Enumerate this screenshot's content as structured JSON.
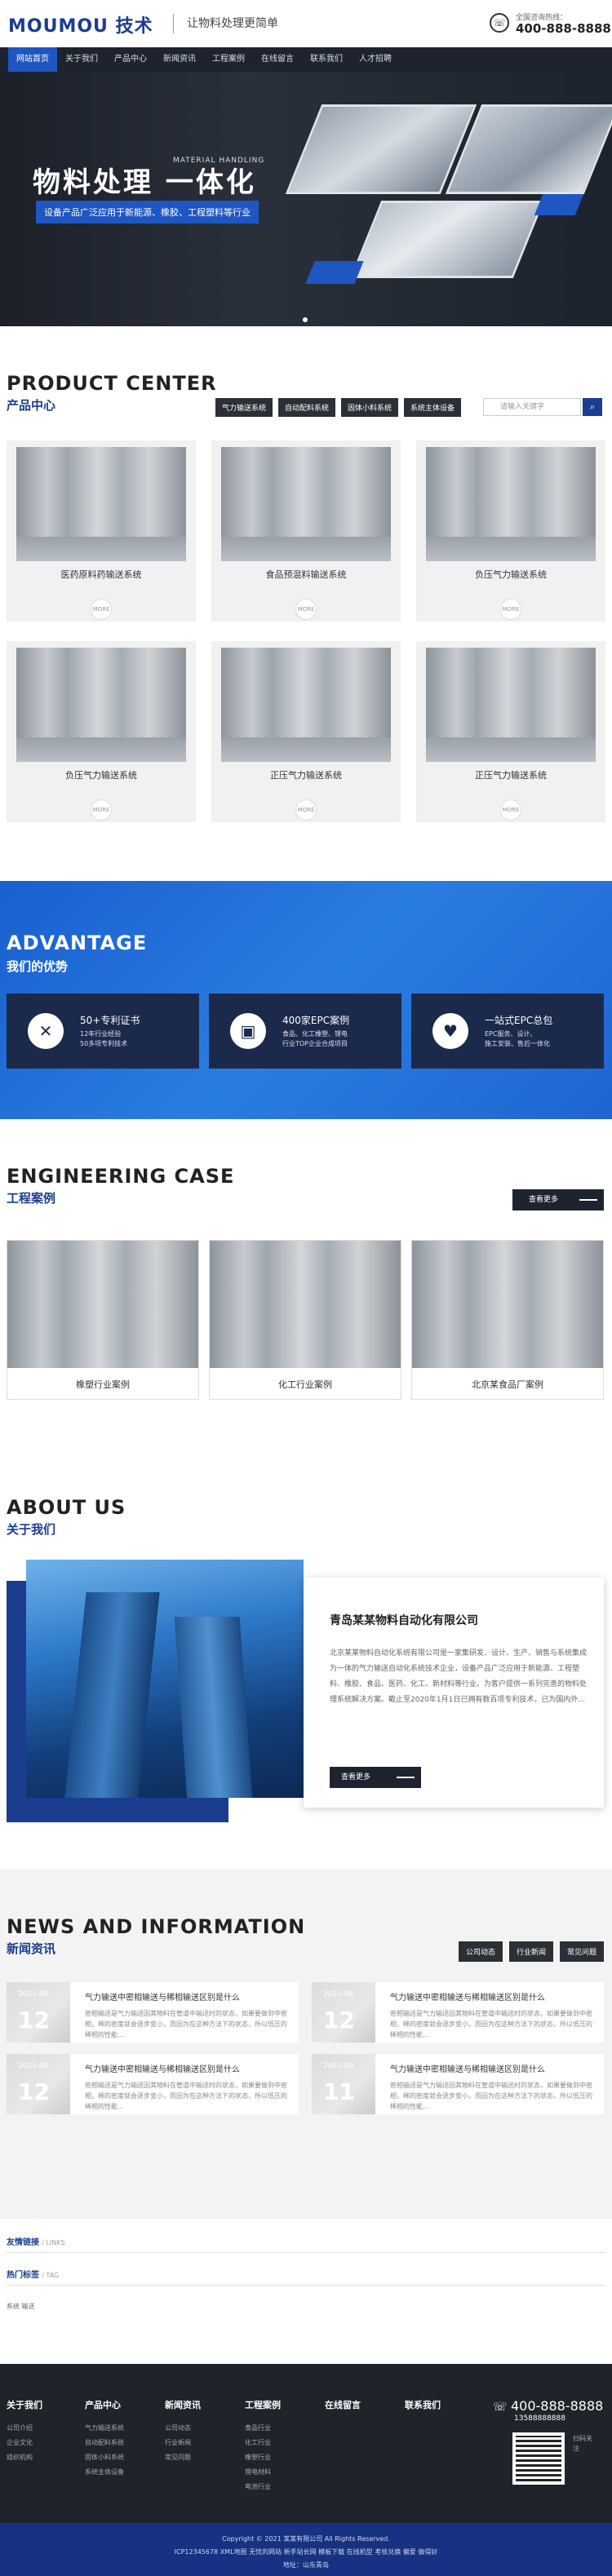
{
  "header": {
    "logo": "MOUMOU 技术",
    "slogan": "让物料处理更简单",
    "hotline_label": "全国咨询热线：",
    "hotline": "400-888-8888",
    "phone_icon": "phone-icon"
  },
  "nav": [
    "网站首页",
    "关于我们",
    "产品中心",
    "新闻资讯",
    "工程案例",
    "在线留言",
    "联系我们",
    "人才招聘"
  ],
  "banner": {
    "title": "物料处理 一体化",
    "subtitle": "MATERIAL HANDLING",
    "tagline": "设备产品广泛应用于新能源、橡胶、工程塑料等行业"
  },
  "products": {
    "title_en": "PRODUCT CENTER",
    "title_cn": "产品中心",
    "tabs": [
      "气力输送系统",
      "自动配料系统",
      "固体小料系统",
      "系统主体设备"
    ],
    "search_placeholder": "请输入关键字",
    "items": [
      {
        "name": "医药原料药输送系统",
        "more": "MORE"
      },
      {
        "name": "食品预混料输送系统",
        "more": "MORE"
      },
      {
        "name": "负压气力输送系统",
        "more": "MORE"
      },
      {
        "name": "负压气力输送系统",
        "more": "MORE"
      },
      {
        "name": "正压气力输送系统",
        "more": "MORE"
      },
      {
        "name": "正压气力输送系统",
        "more": "MORE"
      }
    ]
  },
  "advantage": {
    "title_en": "ADVANTAGE",
    "title_cn": "我们的优势",
    "cards": [
      {
        "title": "50+专利证书",
        "desc": "12年行业经验\n50多项专利技术"
      },
      {
        "title": "400家EPC案例",
        "desc": "食品、化工橡塑、锂电\n行业TOP企业合成项目"
      },
      {
        "title": "一站式EPC总包",
        "desc": "EPC服务、设计、\n施工安装、售后一体化"
      }
    ]
  },
  "cases": {
    "title_en": "ENGINEERING CASE",
    "title_cn": "工程案例",
    "more": "查看更多",
    "items": [
      "橡塑行业案例",
      "化工行业案例",
      "北京某食品厂案例"
    ]
  },
  "about": {
    "title_en": "ABOUT US",
    "title_cn": "关于我们",
    "company": "青岛某某物料自动化有限公司",
    "text": "北京某某物料自动化系统有限公司是一家集研发、设计、生产、销售与系统集成为一体的气力输送自动化系统技术企业，设备产品广泛应用于新能源、工程塑料、橡胶、食品、医药、化工、新材料等行业。为客户提供一系列完善的物料处理系统解决方案。截止至2020年1月1日已拥有数百项专利技术，已为国内外...",
    "more": "查看更多"
  },
  "news": {
    "title_en": "NEWS AND INFORMATION",
    "title_cn": "新闻资讯",
    "tabs": [
      "公司动态",
      "行业新闻",
      "常见问题"
    ],
    "items": [
      {
        "ym": "2021-06",
        "day": "12",
        "title": "气力输送中密相输送与稀相输送区别是什么",
        "desc": "密相输送是气力输送因其物料在管道中输送时的状态，如果要做到中密相，稀的密度就会逐步变小，而因为在这种方法下的状态，所以低压的稀相的性能..."
      },
      {
        "ym": "2021-06",
        "day": "12",
        "title": "气力输送中密相输送与稀相输送区别是什么",
        "desc": "密相输送是气力输送因其物料在管道中输送时的状态，如果要做到中密相，稀的密度就会逐步变小，而因为在这种方法下的状态，所以低压的稀相的性能..."
      },
      {
        "ym": "2021-06",
        "day": "12",
        "title": "气力输送中密相输送与稀相输送区别是什么",
        "desc": "密相输送是气力输送因其物料在管道中输送时的状态，如果要做到中密相，稀的密度就会逐步变小，而因为在这种方法下的状态，所以低压的稀相的性能..."
      },
      {
        "ym": "2021-06",
        "day": "11",
        "title": "气力输送中密相输送与稀相输送区别是什么",
        "desc": "密相输送是气力输送因其物料在管道中输送时的状态，如果要做到中密相，稀的密度就会逐步变小，而因为在这种方法下的状态，所以低压的稀相的性能..."
      }
    ]
  },
  "links": {
    "friend_cn": "友情链接",
    "friend_en": "/ LINKS",
    "tag_cn": "热门标签",
    "tag_en": "/ TAG",
    "tags": "系统  输送"
  },
  "footer": {
    "cols": [
      {
        "title": "关于我们",
        "items": [
          "公司介绍",
          "企业文化",
          "组织机构"
        ]
      },
      {
        "title": "产品中心",
        "items": [
          "气力输送系统",
          "自动配料系统",
          "固体小料系统",
          "系统主体设备"
        ]
      },
      {
        "title": "新闻资讯",
        "items": [
          "公司动态",
          "行业新闻",
          "常见问题"
        ]
      },
      {
        "title": "工程案例",
        "items": [
          "食品行业",
          "化工行业",
          "橡塑行业",
          "锂电材料",
          "电池行业"
        ]
      },
      {
        "title": "在线留言",
        "items": []
      },
      {
        "title": "联系我们",
        "items": []
      }
    ],
    "tel": "400-888-8888",
    "mobile": "13588888888",
    "qr_text": "扫码关注"
  },
  "copyright": {
    "line1": "Copyright © 2021 某某有限公司 All Rights Reserved.",
    "line2": "ICP12345678 XML地图 无忧的网站 新手站长网 模板下载 在线机型 考核兑换 偏爱 做得好",
    "line3": "地址：山东青岛"
  }
}
